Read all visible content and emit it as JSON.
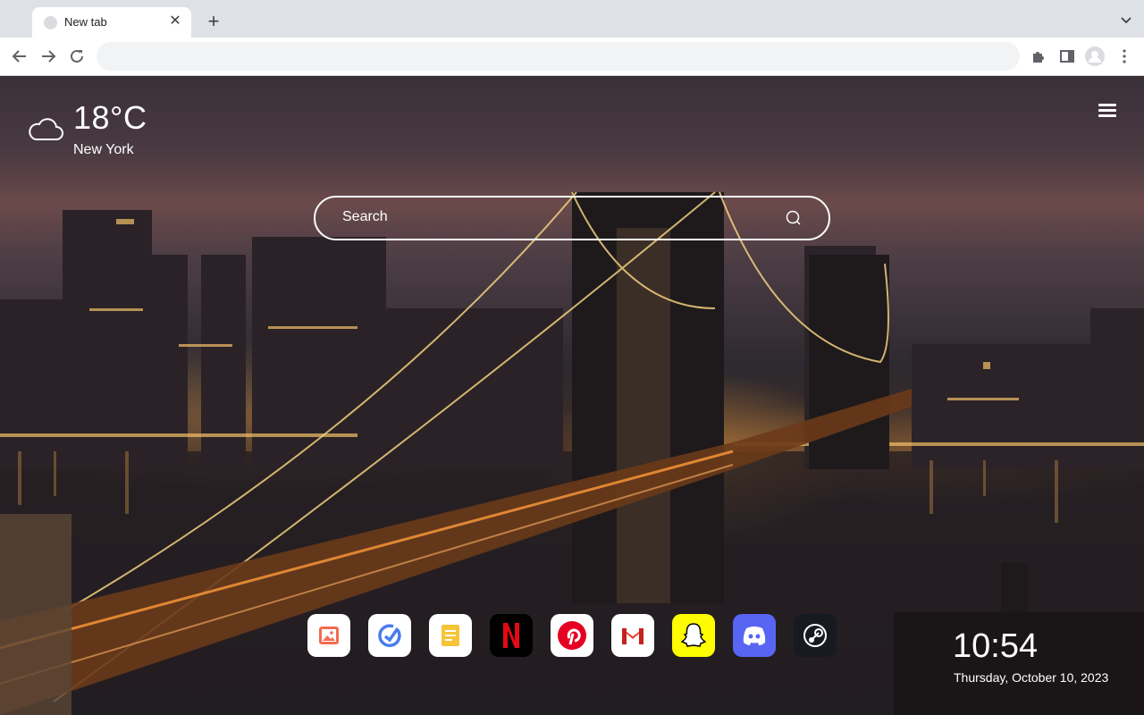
{
  "browser": {
    "tab_title": "New tab",
    "new_tab_symbol": "+",
    "close_symbol": "✕",
    "address_value": ""
  },
  "weather": {
    "temperature": "18°C",
    "city": "New York",
    "icon": "cloud-icon"
  },
  "search": {
    "placeholder": "Search"
  },
  "dock": {
    "apps": [
      "photos-icon",
      "tasks-icon",
      "notes-icon",
      "netflix-icon",
      "pinterest-icon",
      "gmail-icon",
      "snapchat-icon",
      "discord-icon",
      "steam-icon"
    ]
  },
  "clock": {
    "time": "10:54",
    "date": "Thursday, October 10, 2023"
  },
  "colors": {
    "netflix": "#e50914",
    "pinterest": "#e60023",
    "snapchat": "#fffc00",
    "discord": "#5865f2",
    "steam": "#171a21"
  }
}
